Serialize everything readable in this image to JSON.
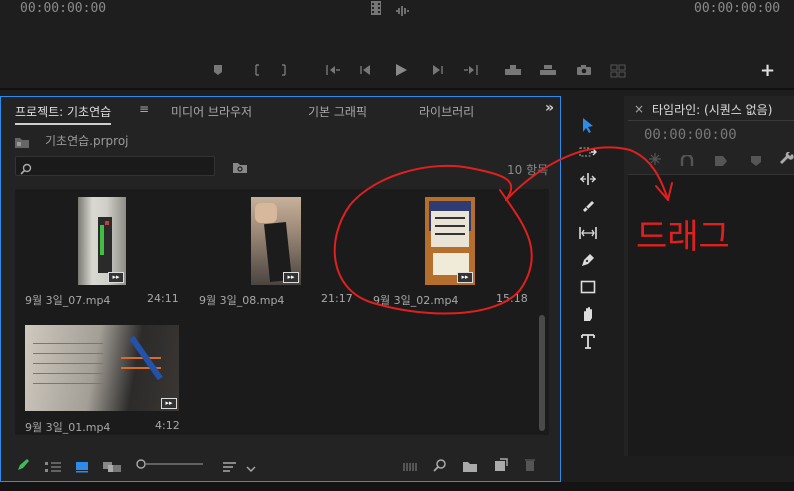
{
  "monitor": {
    "timecode_left": "00:00:00:00",
    "timecode_right": "00:00:00:00",
    "add_label": "+"
  },
  "project": {
    "tabs": [
      {
        "label": "프로젝트: 기초연습"
      },
      {
        "label": "미디어 브라우저"
      },
      {
        "label": "기본 그래픽"
      },
      {
        "label": "라이브러리"
      }
    ],
    "menu_glyph": "≡",
    "expand_glyph": "»",
    "project_file": "기초연습.prproj",
    "search_placeholder": "",
    "item_count": "10 항목",
    "clips": [
      {
        "name": "9월 3일_07.mp4",
        "duration": "24:11"
      },
      {
        "name": "9월 3일_08.mp4",
        "duration": "21:17"
      },
      {
        "name": "9월 3일_02.mp4",
        "duration": "15:18"
      },
      {
        "name": "9월 3일_01.mp4",
        "duration": "4:12"
      }
    ],
    "audio_badge": "▸▸"
  },
  "timeline": {
    "close_glyph": "×",
    "title": "타임라인: (시퀀스 없음)",
    "timecode": "00:00:00:00"
  },
  "annotation": {
    "text": "드래그",
    "color": "#e0201e"
  },
  "colors": {
    "accent": "#2d8ceb",
    "tool_active": "#2d8ceb"
  }
}
